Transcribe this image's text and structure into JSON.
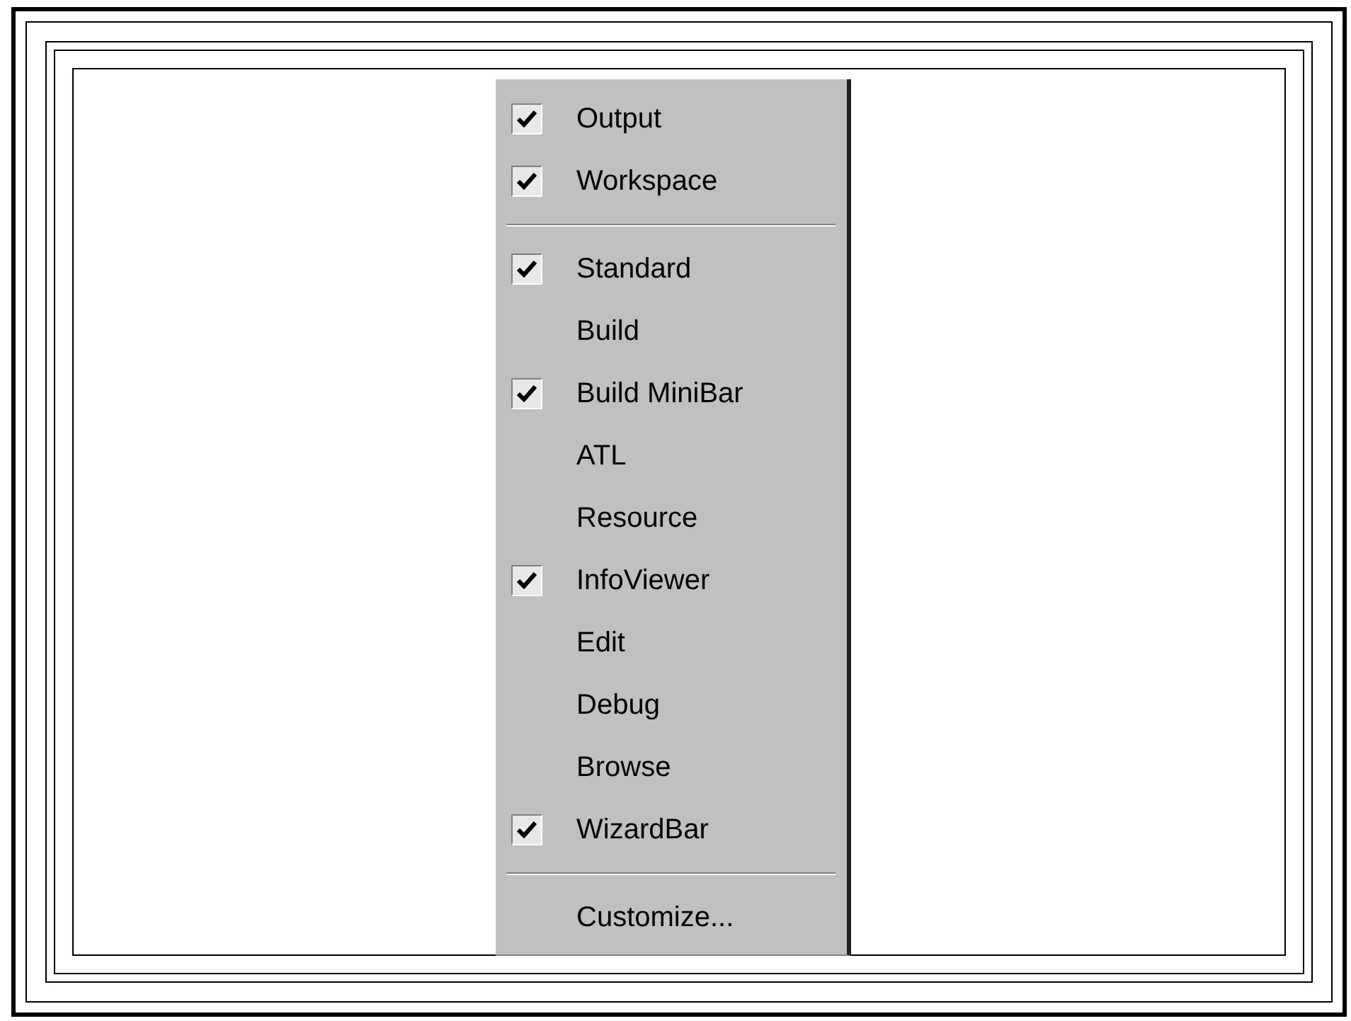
{
  "menu": {
    "items": [
      {
        "kind": "toggle",
        "label": "Output",
        "checked": true
      },
      {
        "kind": "toggle",
        "label": "Workspace",
        "checked": true
      },
      {
        "kind": "separator"
      },
      {
        "kind": "toggle",
        "label": "Standard",
        "checked": true
      },
      {
        "kind": "toggle",
        "label": "Build",
        "checked": false
      },
      {
        "kind": "toggle",
        "label": "Build MiniBar",
        "checked": true
      },
      {
        "kind": "toggle",
        "label": "ATL",
        "checked": false
      },
      {
        "kind": "toggle",
        "label": "Resource",
        "checked": false
      },
      {
        "kind": "toggle",
        "label": "InfoViewer",
        "checked": true
      },
      {
        "kind": "toggle",
        "label": "Edit",
        "checked": false
      },
      {
        "kind": "toggle",
        "label": "Debug",
        "checked": false
      },
      {
        "kind": "toggle",
        "label": "Browse",
        "checked": false
      },
      {
        "kind": "toggle",
        "label": "WizardBar",
        "checked": true
      },
      {
        "kind": "separator"
      },
      {
        "kind": "command",
        "label": "Customize..."
      }
    ]
  }
}
